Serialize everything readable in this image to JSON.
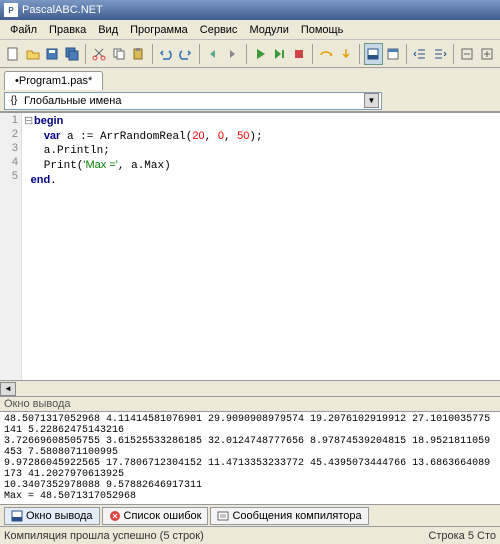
{
  "window": {
    "title": "PascalABC.NET"
  },
  "menu": {
    "items": [
      "Файл",
      "Правка",
      "Вид",
      "Программа",
      "Сервис",
      "Модули",
      "Помощь"
    ]
  },
  "tab": {
    "label": "•Program1.pas*"
  },
  "combo": {
    "label": "Глобальные имена"
  },
  "code": {
    "lines": [
      "begin",
      "  var a := ArrRandomReal(20, 0, 50);",
      "  a.Println;",
      "  Print('Max =', a.Max)",
      "end."
    ]
  },
  "output": {
    "title": "Окно вывода",
    "text": "48.5071317052968 4.11414581076901 29.9090908979574 19.2076102919912 27.1010035775141 5.22862475143216\n3.72669608505755 3.61525533286185 32.0124748777656 8.97874539204815 18.9521811059453 7.5808071100995\n9.97286045922565 17.7806712304152 11.4713353233772 45.4395073444766 13.6863664089173 41.2027970613925\n10.3407352978088 9.57882646917311\nMax = 48.5071317052968"
  },
  "bottom_tabs": {
    "items": [
      "Окно вывода",
      "Список ошибок",
      "Сообщения компилятора"
    ]
  },
  "status": {
    "left": "Компиляция прошла успешно (5 строк)",
    "right": "Строка   5 Сто"
  }
}
